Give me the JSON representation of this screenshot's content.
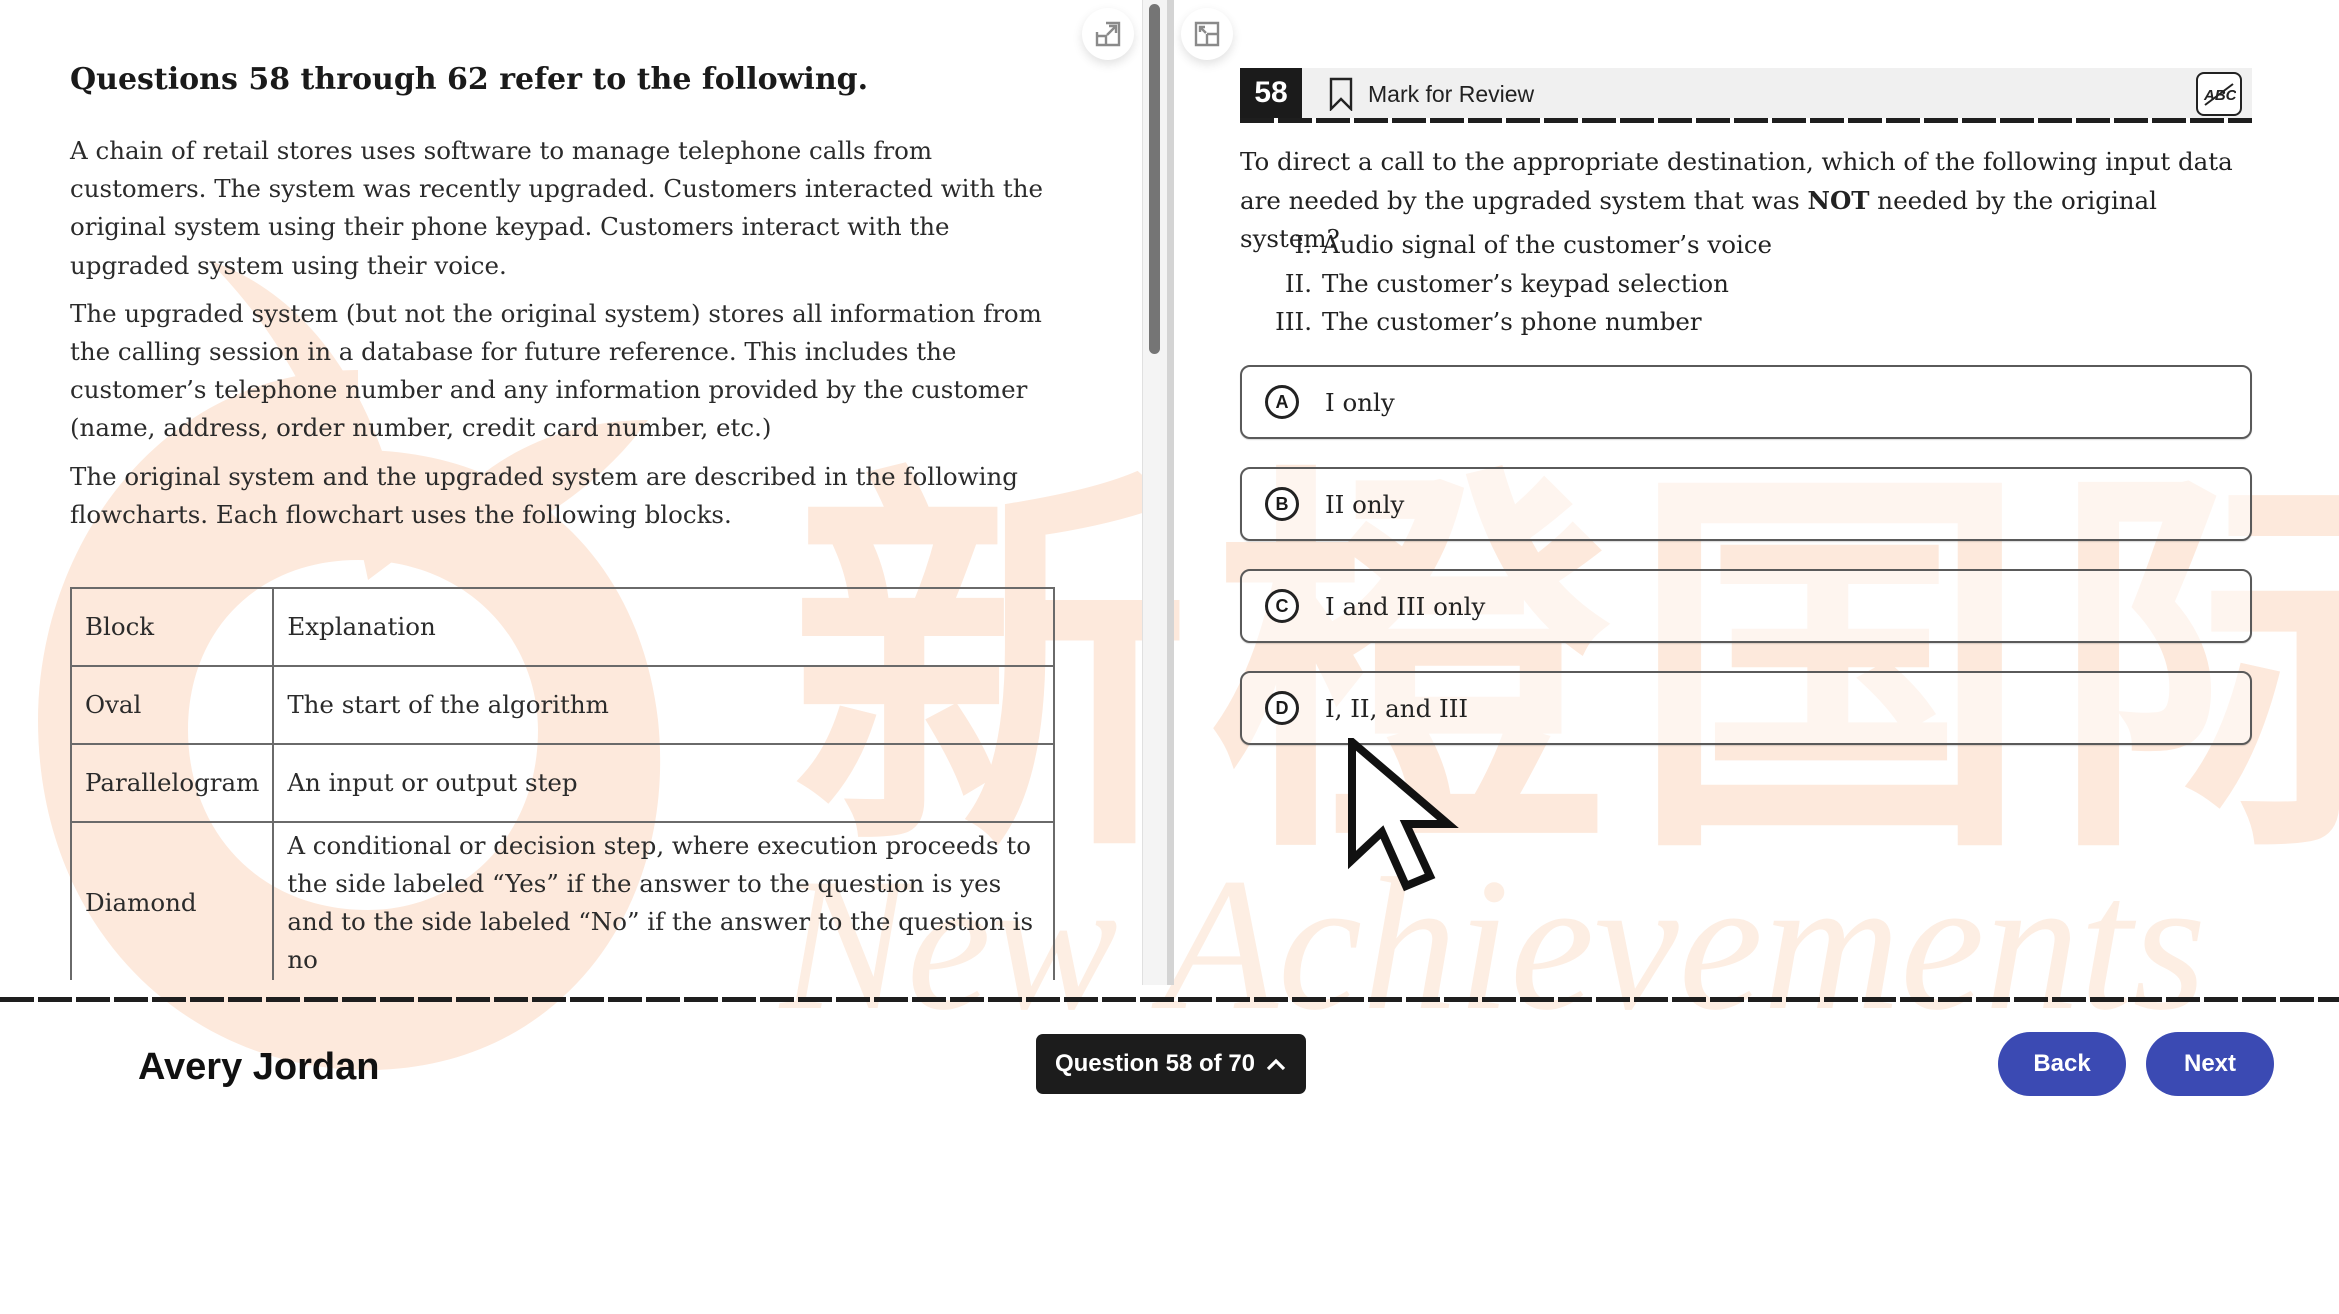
{
  "passage": {
    "title": "Questions 58 through 62 refer to the following.",
    "paragraphs": [
      "A chain of retail stores uses software to manage telephone calls from customers. The system was recently upgraded. Customers interacted with the original system using their phone keypad. Customers interact with the upgraded system using their voice.",
      "The upgraded system (but not the original system) stores all information from the calling session in a database for future reference. This includes the customer’s telephone number and any information provided by the customer (name, address, order number, credit card number, etc.)",
      "The original system and the upgraded system are described in the following flowcharts. Each flowchart uses the following blocks."
    ],
    "table": {
      "headers": [
        "Block",
        "Explanation"
      ],
      "rows": [
        [
          "Oval",
          "The start of the algorithm"
        ],
        [
          "Parallelogram",
          "An input or output step"
        ],
        [
          "Diamond",
          "A conditional or decision step, where execution proceeds to the side labeled “Yes” if the answer to the question is yes and to the side labeled “No” if the answer to the question is no"
        ]
      ]
    }
  },
  "pane_controls": {
    "expand_icon": "expand-icon",
    "collapse_icon": "collapse-icon"
  },
  "question": {
    "number": "58",
    "mark_for_review": "Mark for Review",
    "stem_before": "To direct a call to the appropriate destination, which of the following input data are needed by the upgraded system that was ",
    "stem_bold": "NOT",
    "stem_after": " needed by the original system?",
    "statements": [
      {
        "num": "I.",
        "text": "Audio signal of the customer’s voice"
      },
      {
        "num": "II.",
        "text": "The customer’s keypad selection"
      },
      {
        "num": "III.",
        "text": "The customer’s phone number"
      }
    ],
    "options": [
      {
        "letter": "A",
        "text": "I only"
      },
      {
        "letter": "B",
        "text": "II only"
      },
      {
        "letter": "C",
        "text": "I and III only"
      },
      {
        "letter": "D",
        "text": "I, II, and III"
      }
    ],
    "eliminator_icon": "abc-strikethrough-icon"
  },
  "footer": {
    "student_name": "Avery Jordan",
    "question_nav": "Question 58 of 70",
    "back": "Back",
    "next": "Next",
    "accent_color": "#3b4ab3"
  },
  "watermark": {
    "cn": "新橙国际",
    "en": "New Achievements",
    "color": "#fde9dc"
  }
}
